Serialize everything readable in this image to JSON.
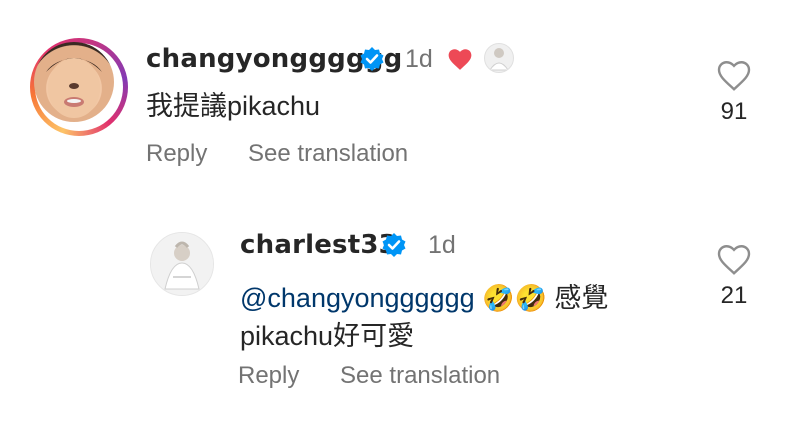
{
  "comments": [
    {
      "username": "changyongggggg",
      "time": "1d",
      "text": "我提議pikachu",
      "reply_label": "Reply",
      "translate_label": "See translation",
      "likes": "91",
      "creator_liked": true
    },
    {
      "username": "charlest33",
      "time": "1d",
      "mention": "@changyongggggg",
      "emoji": "🤣🤣",
      "text_after": "感覺",
      "text_line2": "pikachu好可愛",
      "reply_label": "Reply",
      "translate_label": "See translation",
      "likes": "21"
    }
  ],
  "colors": {
    "verified": "#0095f6",
    "liked_heart": "#ed4956",
    "secondary_text": "#737373",
    "mention": "#00376b"
  },
  "icons": [
    "verified-badge-icon",
    "heart-filled-icon",
    "heart-outline-icon"
  ]
}
